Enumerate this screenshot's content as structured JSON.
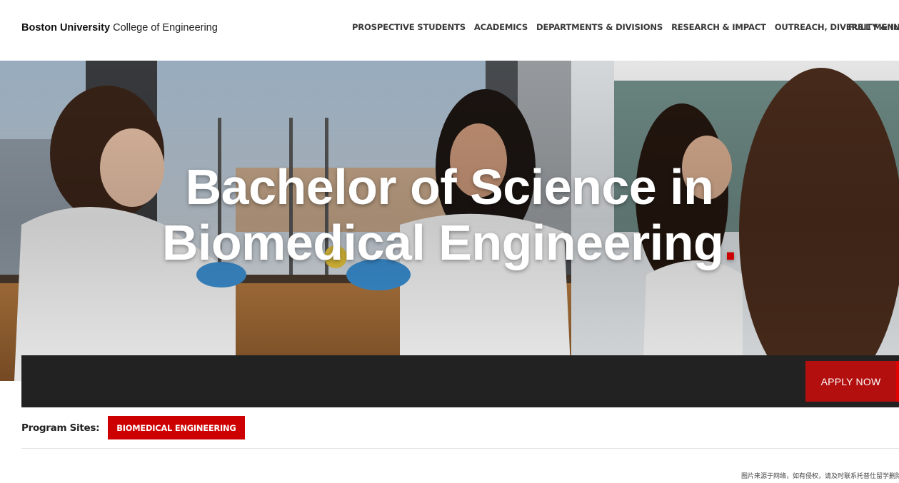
{
  "header": {
    "brand_university": "Boston University",
    "brand_college": "College of Engineering",
    "nav": [
      "PROSPECTIVE STUDENTS",
      "ACADEMICS",
      "DEPARTMENTS & DIVISIONS",
      "RESEARCH & IMPACT",
      "OUTREACH, DIVERSITY & INCLUSION"
    ],
    "full_menu": "FULL MENU"
  },
  "hero": {
    "title_line1": "Bachelor of Science in",
    "title_line2": "Biomedical Engineering",
    "title_dot": ".",
    "image": "lab-students-photo"
  },
  "apply": {
    "label": "APPLY NOW"
  },
  "program_sites": {
    "label": "Program Sites:",
    "tag": "BIOMEDICAL ENGINEERING"
  },
  "watermark": "图片来源于网络，如有侵权，请及时联系托普仕留学删除",
  "colors": {
    "accent_red": "#cc0000",
    "apply_red": "#b30f0f",
    "bar_dark": "#222222"
  }
}
